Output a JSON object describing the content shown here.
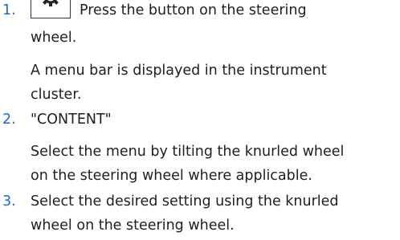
{
  "steps": [
    {
      "number": "1.",
      "icon": "steering-wheel-settings-button-icon",
      "instruction_line1": "Press the button on the steering",
      "instruction_line2": "wheel.",
      "result_line1": "A menu bar is displayed in the instrument",
      "result_line2": "cluster."
    },
    {
      "number": "2.",
      "instruction_line1": "\"CONTENT\"",
      "result_line1": "Select the menu by tilting the knurled wheel",
      "result_line2": "on the steering wheel where applicable."
    },
    {
      "number": "3.",
      "instruction_line1": "Select the desired setting using the knurled",
      "instruction_line2": "wheel on the steering wheel."
    }
  ],
  "colors": {
    "step_number": "#1c69d4",
    "text": "#1f1f1f"
  }
}
